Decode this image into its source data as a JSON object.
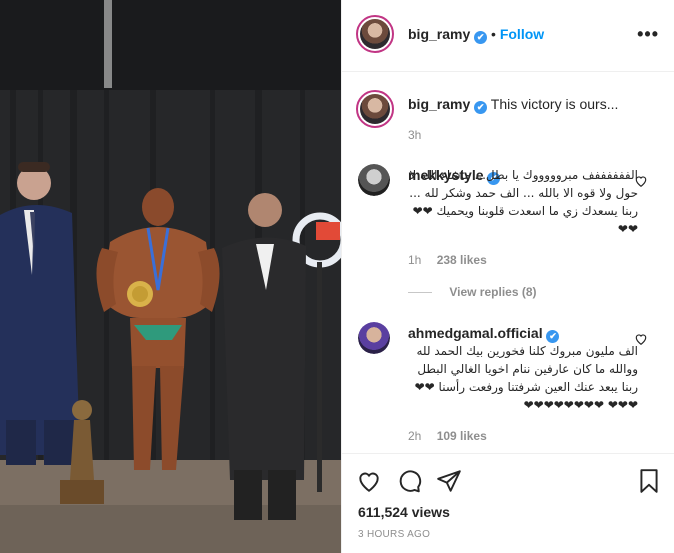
{
  "post_author": {
    "username": "big_ramy",
    "verified_mark": "✔",
    "follow_label": "Follow",
    "more_label": "•••"
  },
  "caption": {
    "username": "big_ramy",
    "text": "This victory is ours...",
    "time": "3h"
  },
  "comments": [
    {
      "username": "mekkystyle",
      "text": "الففففففف مبروووووك يا بطل... ماشاء الله لا حول ولا قوه الا بالله ... الف حمد وشكر لله ... ربنا يسعدك زي ما اسعدت قلوبنا ويحميك ❤❤❤❤",
      "time": "1h",
      "likes": "238 likes",
      "view_replies": "View replies (8)"
    },
    {
      "username": "ahmedgamal.official",
      "text": "الف مليون مبروك كلنا فخورين بيك الحمد لله ووالله ما كان عارفين ننام اخويا الغالي البطل ربنا يبعد عنك العين شرفتنا ورفعت رأسنا ❤❤❤❤❤ ❤❤❤❤❤❤❤❤",
      "time": "2h",
      "likes": "109 likes"
    }
  ],
  "stats": {
    "views": "611,524 views",
    "posted_ago": "3 HOURS AGO"
  },
  "icons": {
    "like": "heart-icon",
    "comment": "comment-icon",
    "share": "share-icon",
    "save": "bookmark-icon",
    "more": "more-options-icon",
    "comment_like": "heart-icon"
  },
  "colors": {
    "link": "#0095f6",
    "verified": "#3897f0",
    "muted": "#8e8e8e",
    "text": "#262626"
  }
}
